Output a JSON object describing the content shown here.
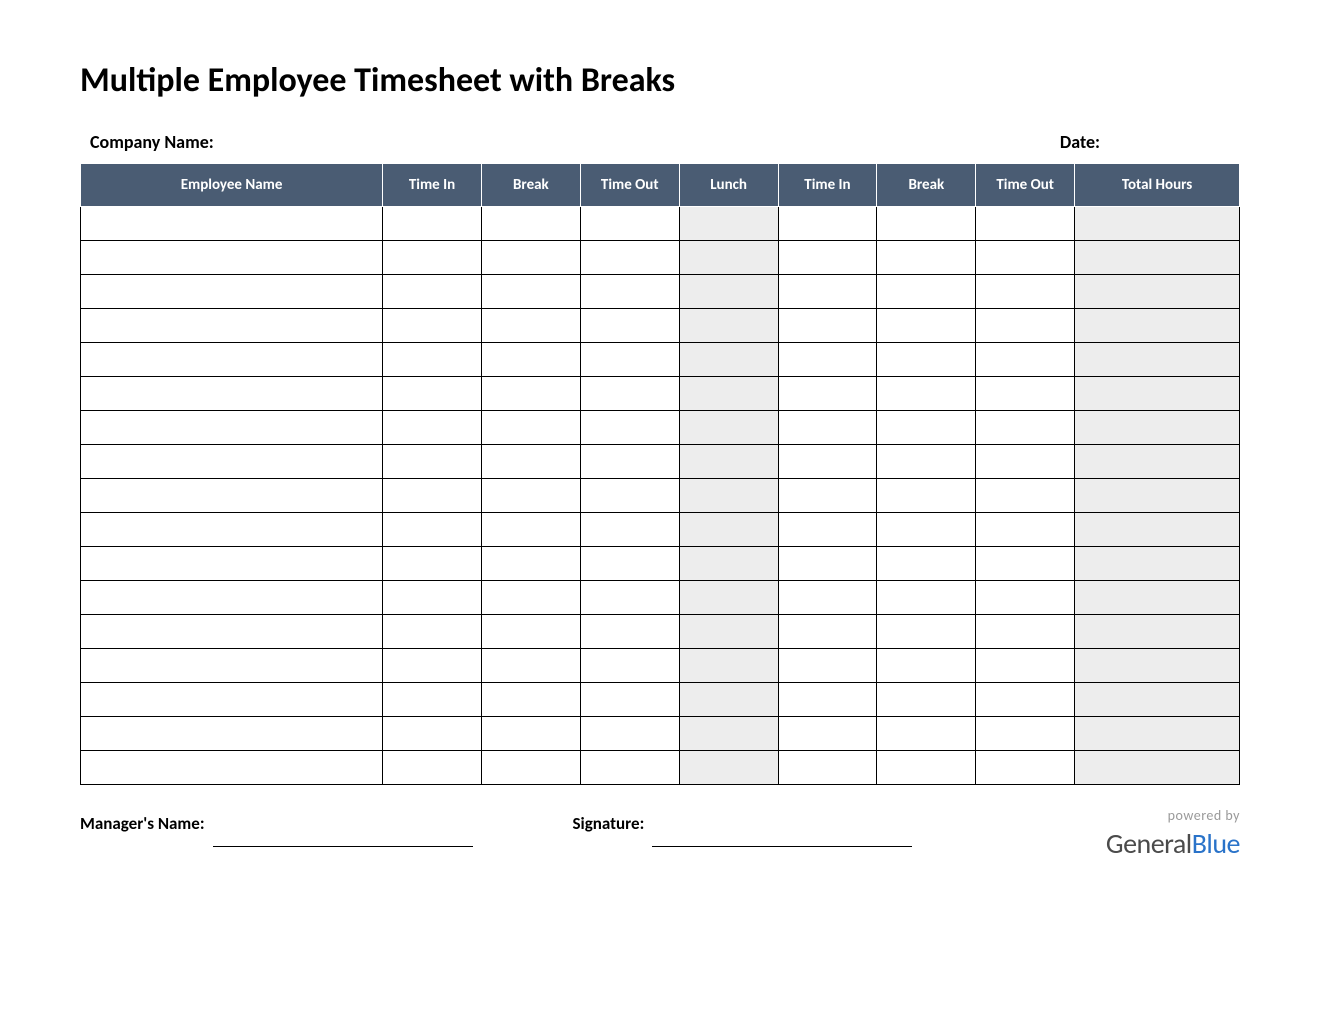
{
  "title": "Multiple Employee Timesheet with Breaks",
  "meta": {
    "company_label": "Company Name:",
    "date_label": "Date:"
  },
  "columns": [
    "Employee Name",
    "Time In",
    "Break",
    "Time Out",
    "Lunch",
    "Time In",
    "Break",
    "Time Out",
    "Total Hours"
  ],
  "shaded_columns": [
    4,
    8
  ],
  "row_count": 17,
  "footer": {
    "manager_label": "Manager's Name:",
    "signature_label": "Signature:"
  },
  "branding": {
    "powered_by": "powered by",
    "logo_part1": "General",
    "logo_part2": "Blue"
  }
}
